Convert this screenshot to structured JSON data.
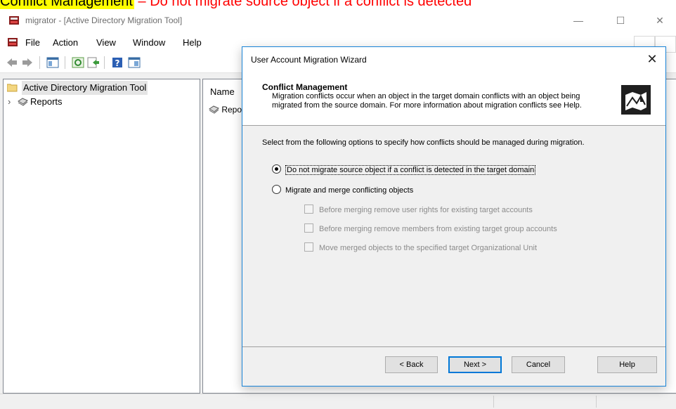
{
  "top_strip": {
    "highlight_text": "Conflict Management",
    "rest_text": " – Do not migrate source object if a conflict is detected"
  },
  "window": {
    "title": "migrator - [Active Directory Migration Tool]",
    "minimize_glyph": "—",
    "maximize_glyph": "☐",
    "close_glyph": "✕"
  },
  "menubar": {
    "items": [
      "File",
      "Action",
      "View",
      "Window",
      "Help"
    ]
  },
  "tree": {
    "root_label": "Active Directory Migration Tool",
    "child_label": "Reports",
    "expander": "›"
  },
  "list": {
    "column_name": "Name",
    "row_label": "Repo"
  },
  "dialog": {
    "title": "User Account Migration Wizard",
    "close_glyph": "✕",
    "header_title": "Conflict Management",
    "header_description": "Migration conflicts occur when an object in the target domain conflicts with an object being migrated from the source domain. For more information about migration conflicts see Help.",
    "intro": "Select from the following options to specify how conflicts should be managed during migration.",
    "options": {
      "do_not_migrate": "Do not migrate source object if a conflict is detected in the target domain",
      "migrate_merge": "Migrate and merge conflicting objects"
    },
    "selected_option": "do_not_migrate",
    "checkboxes": {
      "remove_rights": "Before merging remove user rights for existing target accounts",
      "remove_members": "Before merging remove members from existing target group accounts",
      "move_objects": "Move merged objects to the specified target Organizational Unit"
    },
    "buttons": {
      "back": "< Back",
      "next": "Next >",
      "cancel": "Cancel",
      "help": "Help"
    }
  },
  "colors": {
    "highlight": "#ffff00",
    "red_text": "#ff0000",
    "dialog_border": "#1883d7",
    "default_button_border": "#0078d7"
  },
  "icons": {
    "app": "migration-tool-icon",
    "back": "back-arrow-icon",
    "forward": "forward-arrow-icon",
    "folder": "folder-icon",
    "reports": "reports-book-icon",
    "wizard": "wizard-map-icon"
  }
}
